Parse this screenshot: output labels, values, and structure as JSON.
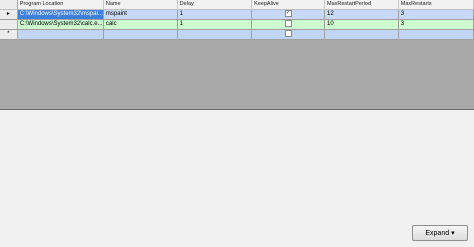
{
  "columns": [
    "Program Location",
    "Name",
    "Delay",
    "KeepAlive",
    "MaxRestartPeriod",
    "MaxRestarts"
  ],
  "rows": [
    {
      "indicator": "▸",
      "location": "C:\\Windows\\System32\\mspai...",
      "name": "mspaint",
      "delay": "1",
      "keepalive": true,
      "period": "12",
      "restarts": "3"
    },
    {
      "indicator": "",
      "location": "C:\\Windows\\System32\\calc.e...",
      "name": "calc",
      "delay": "1",
      "keepalive": false,
      "period": "10",
      "restarts": "3"
    }
  ],
  "new_row": {
    "indicator": "*"
  },
  "expand_button": {
    "label": "Expand",
    "arrow": "▾"
  },
  "colors": {
    "selected_cell": "#3c7fdc",
    "row1": "#c8d8f8",
    "row2": "#cdfbcf",
    "new_row": "#c0d6f4",
    "grid_empty": "#a9a9a9"
  }
}
